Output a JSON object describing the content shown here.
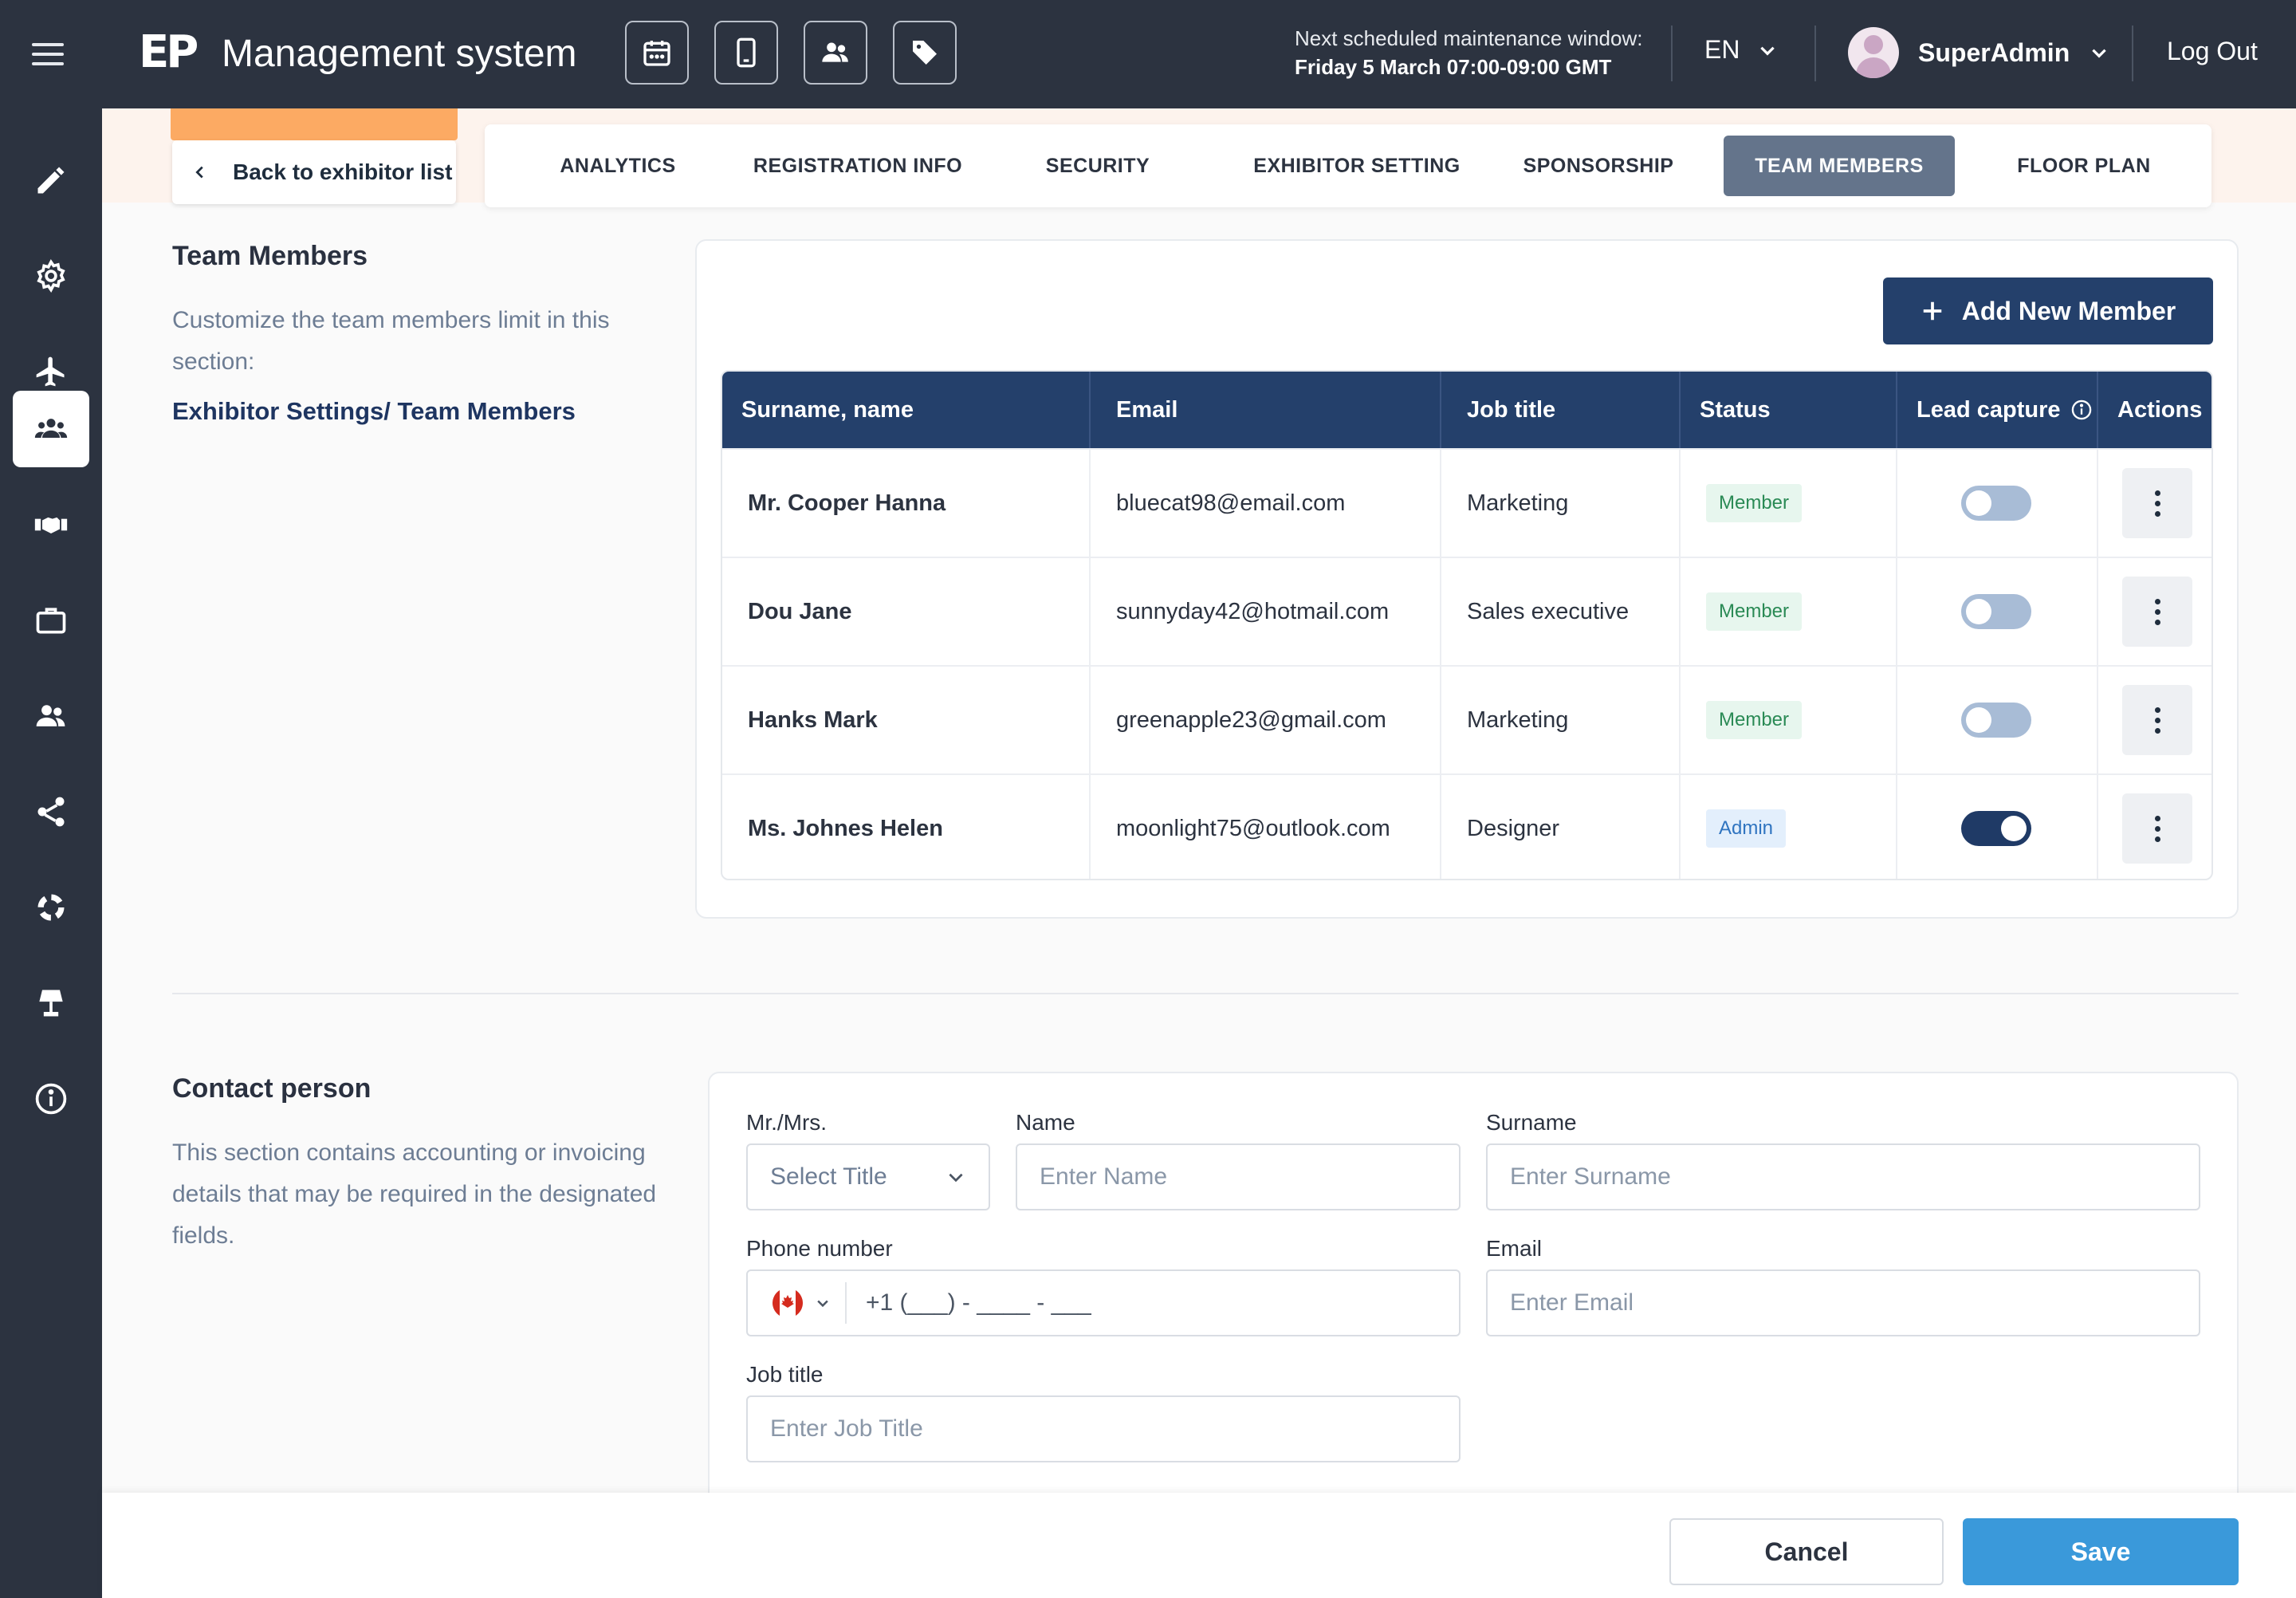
{
  "header": {
    "logo_text": "EP",
    "app_title": "Management system",
    "icons": [
      "calendar-icon",
      "mobile-icon",
      "people-icon",
      "tag-icon"
    ],
    "maintenance_line1": "Next scheduled maintenance window:",
    "maintenance_line2": "Friday 5 March 07:00-09:00 GMT",
    "language": "EN",
    "user_name": "SuperAdmin",
    "logout_label": "Log Out"
  },
  "sidebar": {
    "items": [
      {
        "icon": "pencil-icon",
        "active": false
      },
      {
        "icon": "gear-icon",
        "active": false
      },
      {
        "icon": "airplane-icon",
        "active": false
      },
      {
        "icon": "team-icon",
        "active": true
      },
      {
        "icon": "handshake-icon",
        "active": false
      },
      {
        "icon": "briefcase-icon",
        "active": false
      },
      {
        "icon": "users-icon",
        "active": false
      },
      {
        "icon": "share-icon",
        "active": false
      },
      {
        "icon": "lifebuoy-icon",
        "active": false
      },
      {
        "icon": "lamp-icon",
        "active": false
      },
      {
        "icon": "info-icon",
        "active": false
      }
    ]
  },
  "nav": {
    "back_label": "Back to exhibitor list",
    "tabs": [
      {
        "label": "ANALYTICS",
        "active": false
      },
      {
        "label": "REGISTRATION INFO",
        "active": false
      },
      {
        "label": "SECURITY",
        "active": false
      },
      {
        "label": "EXHIBITOR SETTING",
        "active": false
      },
      {
        "label": "SPONSORSHIP",
        "active": false
      },
      {
        "label": "TEAM MEMBERS",
        "active": true
      },
      {
        "label": "FLOOR PLAN",
        "active": false
      }
    ]
  },
  "team": {
    "title": "Team Members",
    "description": "Customize the team members limit in this section:",
    "link": "Exhibitor Settings/ Team Members",
    "add_button": "Add New Member",
    "columns": [
      "Surname, name",
      "Email",
      "Job title",
      "Status",
      "Lead capture",
      "Actions"
    ],
    "rows": [
      {
        "name": "Mr. Cooper Hanna",
        "email": "bluecat98@email.com",
        "job": "Marketing",
        "status": "Member",
        "lead_capture": false
      },
      {
        "name": "Dou Jane",
        "email": "sunnyday42@hotmail.com",
        "job": "Sales executive",
        "status": "Member",
        "lead_capture": false
      },
      {
        "name": "Hanks Mark",
        "email": "greenapple23@gmail.com",
        "job": "Marketing",
        "status": "Member",
        "lead_capture": false
      },
      {
        "name": "Ms. Johnes Helen",
        "email": "moonlight75@outlook.com",
        "job": "Designer",
        "status": "Admin",
        "lead_capture": true
      }
    ]
  },
  "contact": {
    "title": "Contact person",
    "description": "This section contains accounting or invoicing details that may be required in the designated fields.",
    "title_label": "Mr./Mrs.",
    "title_placeholder": "Select Title",
    "name_label": "Name",
    "name_placeholder": "Enter Name",
    "surname_label": "Surname",
    "surname_placeholder": "Enter Surname",
    "phone_label": "Phone number",
    "phone_value": "+1 (___) - ____ - ___",
    "email_label": "Email",
    "email_placeholder": "Enter Email",
    "job_label": "Job title",
    "job_placeholder": "Enter Job Title"
  },
  "footer": {
    "cancel_label": "Cancel",
    "save_label": "Save"
  },
  "colors": {
    "nav_bg": "#2c3340",
    "table_header": "#24406b",
    "save_blue": "#3a99da",
    "accent_orange": "#fcaa63"
  }
}
